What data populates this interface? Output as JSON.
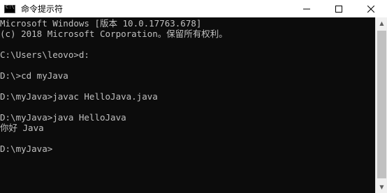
{
  "window": {
    "title": "命令提示符",
    "controls": {
      "minimize": "—",
      "maximize": "□",
      "close": "✕"
    }
  },
  "console": {
    "lines": [
      "Microsoft Windows [版本 10.0.17763.678]",
      "(c) 2018 Microsoft Corporation。保留所有权利。",
      "",
      "C:\\Users\\leovo>d:",
      "",
      "D:\\>cd myJava",
      "",
      "D:\\myJava>javac HelloJava.java",
      "",
      "D:\\myJava>java HelloJava",
      "你好 Java",
      "",
      "D:\\myJava>"
    ]
  },
  "colors": {
    "console_background": "#0c0c0c",
    "console_text": "#c0c0c0",
    "titlebar": "#ffffff"
  }
}
